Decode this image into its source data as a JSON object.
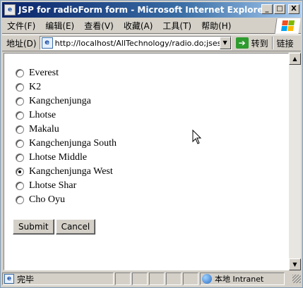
{
  "window": {
    "title": "JSP for radioForm form - Microsoft Internet Explorer",
    "title_icon": "e",
    "controls": {
      "minimize": "_",
      "maximize": "□",
      "close": "X"
    }
  },
  "menu": {
    "items": [
      "文件(F)",
      "编辑(E)",
      "查看(V)",
      "收藏(A)",
      "工具(T)",
      "帮助(H)"
    ]
  },
  "address": {
    "label": "地址(D)",
    "url": "http://localhost/AllTechnology/radio.do;jsessionid",
    "go_label": "转到",
    "links_label": "链接"
  },
  "form": {
    "options": [
      {
        "label": "Everest",
        "checked": false
      },
      {
        "label": "K2",
        "checked": false
      },
      {
        "label": "Kangchenjunga",
        "checked": false
      },
      {
        "label": "Lhotse",
        "checked": false
      },
      {
        "label": "Makalu",
        "checked": false
      },
      {
        "label": "Kangchenjunga South",
        "checked": false
      },
      {
        "label": "Lhotse Middle",
        "checked": false
      },
      {
        "label": "Kangchenjunga West",
        "checked": true
      },
      {
        "label": "Lhotse Shar",
        "checked": false
      },
      {
        "label": "Cho Oyu",
        "checked": false
      }
    ],
    "submit_label": "Submit",
    "cancel_label": "Cancel"
  },
  "scrollbar": {
    "up": "▲",
    "down": "▼"
  },
  "status": {
    "text": "完毕",
    "zone": "本地 Intranet"
  },
  "colors": {
    "titlebar_start": "#0a246a",
    "titlebar_end": "#a6caf0",
    "chrome": "#d4d0c8"
  }
}
